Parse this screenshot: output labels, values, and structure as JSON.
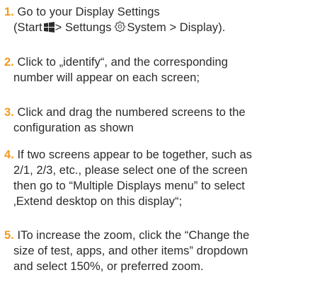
{
  "steps": [
    {
      "number": "1.",
      "lines": [
        "Go to your Display Settings",
        "(Start",
        "> Settungs",
        "System > Display)."
      ]
    },
    {
      "number": "2.",
      "lines": [
        "Click to „identify“, and the corresponding",
        "number will appear on each screen;"
      ]
    },
    {
      "number": "3.",
      "lines": [
        "Click and drag the numbered screens to the",
        "configuration as shown"
      ]
    },
    {
      "number": "4.",
      "lines": [
        "If two screens appear to be together, such as",
        "2/1, 2/3, etc., please select one of the screen",
        "then go to “Multiple Displays menu” to select",
        "‚Extend desktop on this display“;"
      ]
    },
    {
      "number": "5.",
      "lines": [
        "ITo increase the zoom, click the “Change the",
        "size of test, apps, and other items” dropdown",
        "and select 150%, or preferred zoom."
      ]
    }
  ],
  "icons": {
    "start": "windows-logo-icon",
    "settings": "gear-icon"
  },
  "colors": {
    "number": "#f39a1c",
    "text": "#2b2b2b",
    "background": "#ffffff"
  }
}
